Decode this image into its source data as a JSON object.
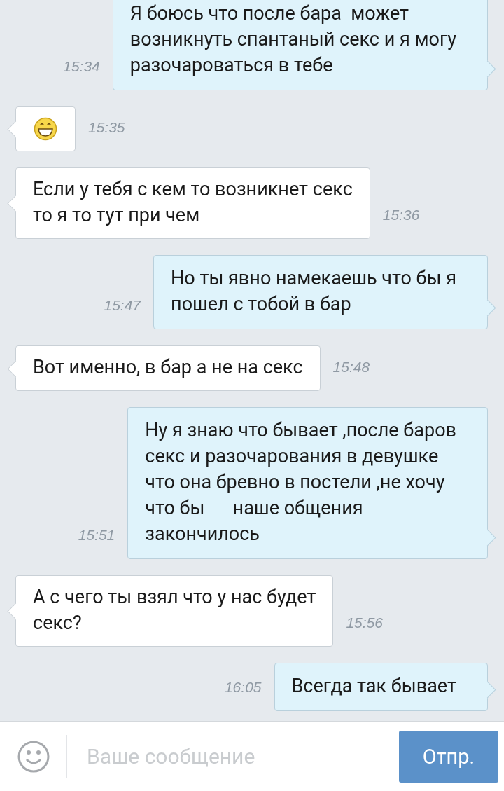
{
  "messages": [
    {
      "outgoing": true,
      "kind": "text",
      "text": "Я боюсь что после бара  может\nвозникнуть спантаный секс и я могу\nразочароваться в тебе",
      "time": "15:34"
    },
    {
      "outgoing": false,
      "kind": "emoji",
      "time": "15:35"
    },
    {
      "outgoing": false,
      "kind": "text",
      "text": "Если у тебя с кем то возникнет секс\nто я то тут при чем",
      "time": "15:36"
    },
    {
      "outgoing": true,
      "kind": "text",
      "text": "Но ты явно намекаешь что бы я\nпошел с тобой в бар",
      "time": "15:47"
    },
    {
      "outgoing": false,
      "kind": "text",
      "text": "Вот именно, в бар а не на секс",
      "time": "15:48"
    },
    {
      "outgoing": true,
      "kind": "text",
      "text": "Ну я знаю что бывает ,после баров\nсекс и разочарования в девушке\nчто она бревно в постели ,не хочу\nчто бы      наше общения\nзакончилось",
      "time": "15:51"
    },
    {
      "outgoing": false,
      "kind": "text",
      "text": "А с чего ты взял что у нас будет\nсекс?",
      "time": "15:56"
    },
    {
      "outgoing": true,
      "kind": "text",
      "text": "Всегда так бывает",
      "time": "16:05"
    }
  ],
  "composer": {
    "placeholder": "Ваше сообщение",
    "send_label": "Отпр."
  }
}
